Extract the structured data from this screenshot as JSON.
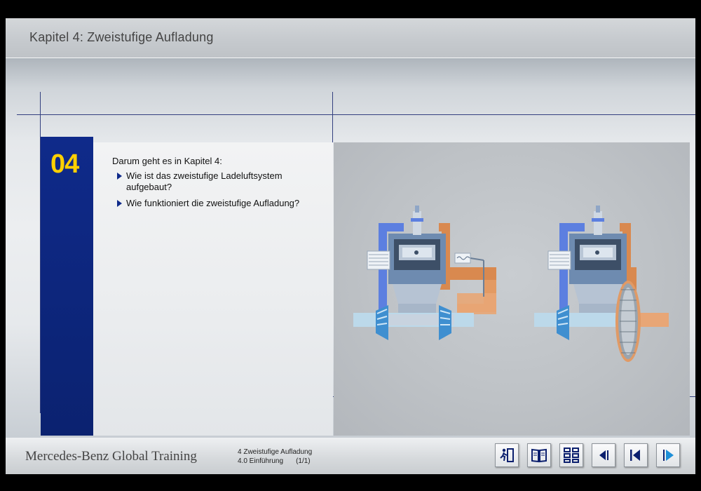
{
  "header": {
    "title": "Kapitel 4: Zweistufige Aufladung"
  },
  "chapter": {
    "number": "04",
    "intro": "Darum geht es in Kapitel 4:",
    "bullets": [
      "Wie ist das zweistufige Ladeluftsystem aufgebaut?",
      "Wie funktioniert die zweistufige Aufladung?"
    ]
  },
  "figure": {
    "diagrams": [
      "engine-with-turbo-and-wastegate-diagram",
      "engine-with-turbo-and-compressor-wheel-diagram"
    ]
  },
  "footer": {
    "brand": "Mercedes-Benz Global Training",
    "section": "4 Zweistufige Aufladung",
    "subsection": "4.0 Einführung",
    "page": "(1/1)"
  },
  "nav_buttons": [
    {
      "icon": "exit-icon"
    },
    {
      "icon": "glossary-book-icon"
    },
    {
      "icon": "sitemap-icon"
    },
    {
      "icon": "previous-arrow-icon"
    },
    {
      "icon": "back-to-start-icon"
    },
    {
      "icon": "next-arrow-icon"
    }
  ],
  "colors": {
    "chapter_blue": "#0f2a8a",
    "chapter_number_yellow": "#ffd000",
    "diagram_blue": "#5c7fe0",
    "diagram_orange": "#d9894f",
    "nav_accent": "#1e8fd8"
  }
}
